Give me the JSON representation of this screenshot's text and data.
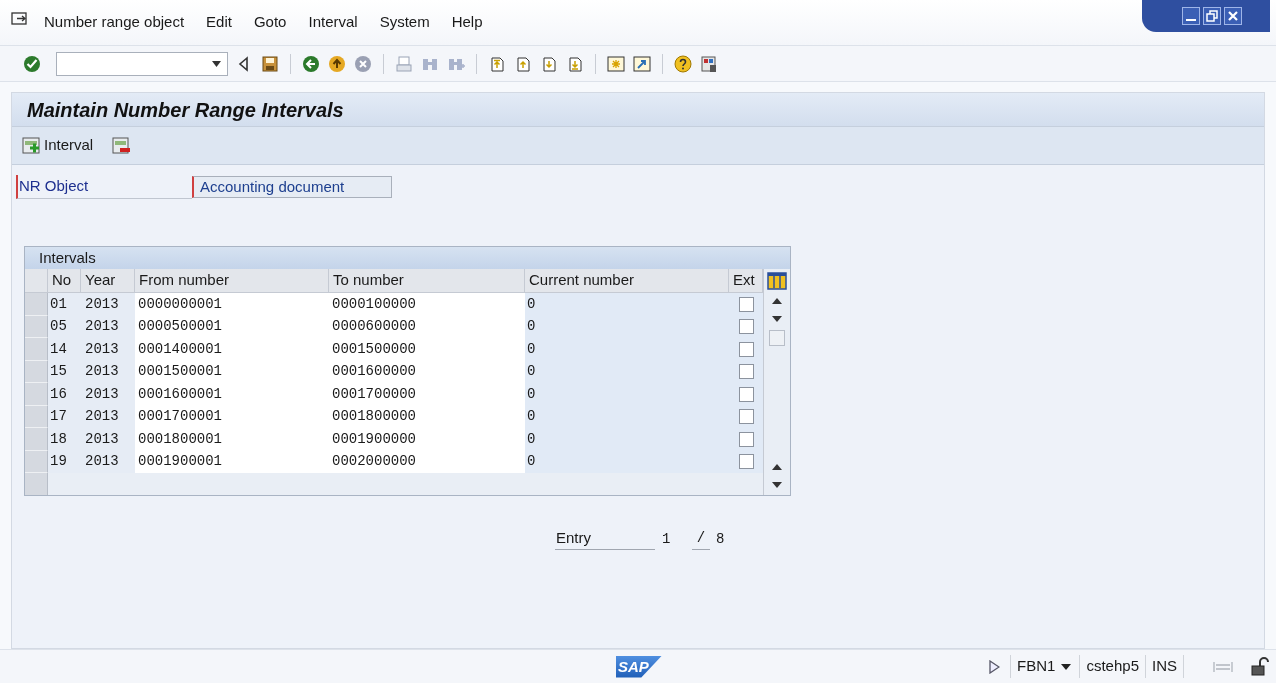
{
  "menu": [
    {
      "label": "Number range object"
    },
    {
      "label": "Edit"
    },
    {
      "label": "Goto"
    },
    {
      "label": "Interval"
    },
    {
      "label": "System"
    },
    {
      "label": "Help"
    }
  ],
  "title": "Maintain Number Range Intervals",
  "app_toolbar": {
    "interval_button": "Interval"
  },
  "field": {
    "label": "NR Object",
    "value": "Accounting document"
  },
  "table": {
    "title": "Intervals",
    "columns": [
      "No",
      "Year",
      "From number",
      "To number",
      "Current number",
      "Ext"
    ],
    "rows": [
      {
        "no": "01",
        "year": "2013",
        "from": "0000000001",
        "to": "0000100000",
        "current": "0",
        "ext": false
      },
      {
        "no": "05",
        "year": "2013",
        "from": "0000500001",
        "to": "0000600000",
        "current": "0",
        "ext": false
      },
      {
        "no": "14",
        "year": "2013",
        "from": "0001400001",
        "to": "0001500000",
        "current": "0",
        "ext": false
      },
      {
        "no": "15",
        "year": "2013",
        "from": "0001500001",
        "to": "0001600000",
        "current": "0",
        "ext": false
      },
      {
        "no": "16",
        "year": "2013",
        "from": "0001600001",
        "to": "0001700000",
        "current": "0",
        "ext": false
      },
      {
        "no": "17",
        "year": "2013",
        "from": "0001700001",
        "to": "0001800000",
        "current": "0",
        "ext": false
      },
      {
        "no": "18",
        "year": "2013",
        "from": "0001800001",
        "to": "0001900000",
        "current": "0",
        "ext": false
      },
      {
        "no": "19",
        "year": "2013",
        "from": "0001900001",
        "to": "0002000000",
        "current": "0",
        "ext": false
      }
    ]
  },
  "entry": {
    "label": "Entry",
    "current": "1",
    "separator": "/",
    "total": "8"
  },
  "status_bar": {
    "logo": "SAP",
    "transaction": "FBN1",
    "server": "cstehp5",
    "mode": "INS"
  }
}
